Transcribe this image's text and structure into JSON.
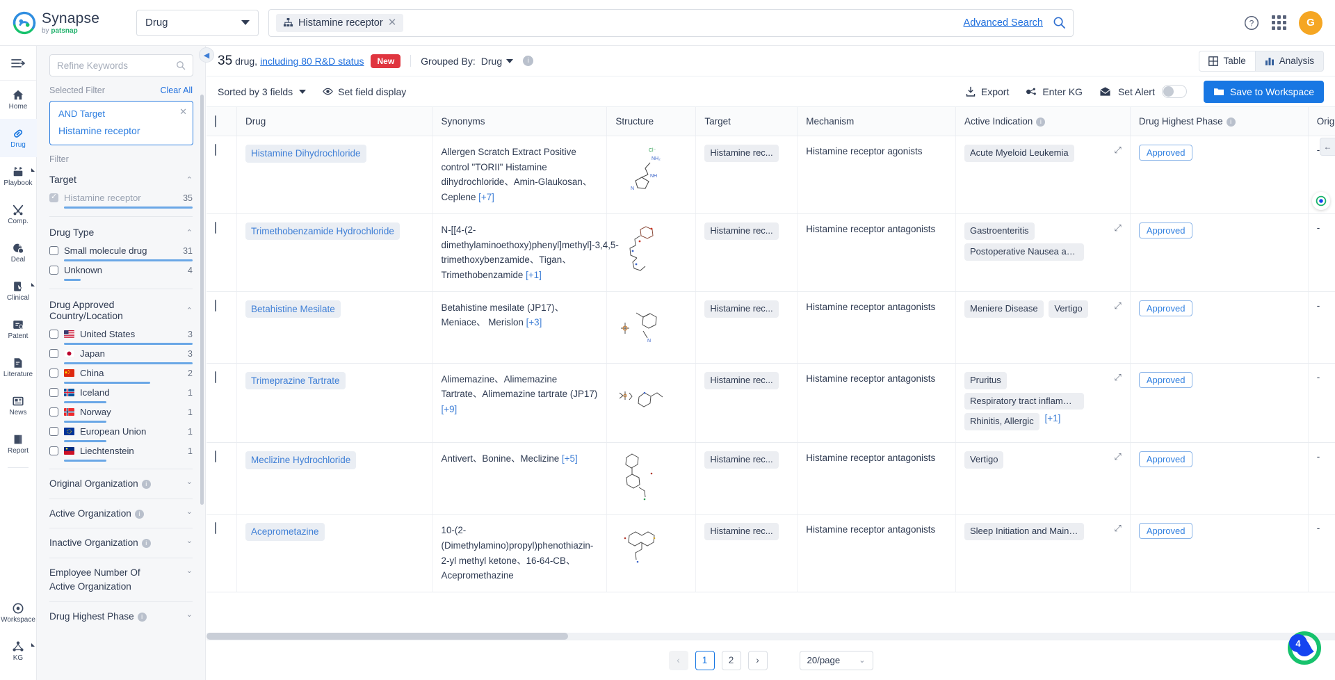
{
  "brand": {
    "name": "Synapse",
    "by": "by",
    "company": "patsnap"
  },
  "topbar": {
    "entity_select": "Drug",
    "query_chip": "Histamine receptor",
    "query_chip_icon": "target-hierarchy-icon",
    "advanced_search": "Advanced Search",
    "search_icon": "search-icon",
    "help_icon": "help-circle-icon",
    "apps_icon": "apps-grid-icon",
    "avatar_initial": "G",
    "avatar_color": "#f5a623"
  },
  "rail": {
    "toggle": "collapse-rail",
    "items": [
      {
        "label": "Home",
        "icon": "home-icon",
        "active": false,
        "sub": false
      },
      {
        "label": "Drug",
        "icon": "capsule-icon",
        "active": true,
        "sub": false
      },
      {
        "label": "Playbook",
        "icon": "playbook-icon",
        "active": false,
        "sub": true
      },
      {
        "label": "Comp.",
        "icon": "competition-icon",
        "active": false,
        "sub": false
      },
      {
        "label": "Deal",
        "icon": "deal-icon",
        "active": false,
        "sub": false
      },
      {
        "label": "Clinical",
        "icon": "clinical-icon",
        "active": false,
        "sub": true
      },
      {
        "label": "Patent",
        "icon": "patent-icon",
        "active": false,
        "sub": false
      },
      {
        "label": "Literature",
        "icon": "literature-icon",
        "active": false,
        "sub": false
      },
      {
        "label": "News",
        "icon": "news-icon",
        "active": false,
        "sub": false
      },
      {
        "label": "Report",
        "icon": "report-icon",
        "active": false,
        "sub": false
      }
    ],
    "bottom_items": [
      {
        "label": "Workspace",
        "icon": "workspace-icon"
      },
      {
        "label": "KG",
        "icon": "knowledge-graph-icon",
        "sub": true
      }
    ]
  },
  "sidebar": {
    "refine_placeholder": "Refine Keywords",
    "selected_filter_label": "Selected Filter",
    "clear_all": "Clear All",
    "selected": {
      "operator": "AND Target",
      "value": "Histamine receptor"
    },
    "filter_label": "Filter",
    "groups": [
      {
        "title": "Target",
        "expanded": true,
        "items": [
          {
            "label": "Histamine receptor",
            "count": "35",
            "checked": true,
            "bar": 100,
            "flag": null
          }
        ]
      },
      {
        "title": "Drug Type",
        "expanded": true,
        "items": [
          {
            "label": "Small molecule drug",
            "count": "31",
            "checked": false,
            "bar": 100,
            "flag": null
          },
          {
            "label": "Unknown",
            "count": "4",
            "checked": false,
            "bar": 13,
            "flag": null
          }
        ]
      },
      {
        "title": "Drug Approved Country/Location",
        "expanded": true,
        "items": [
          {
            "label": "United States",
            "count": "3",
            "checked": false,
            "bar": 100,
            "flag": "us"
          },
          {
            "label": "Japan",
            "count": "3",
            "checked": false,
            "bar": 100,
            "flag": "jp"
          },
          {
            "label": "China",
            "count": "2",
            "checked": false,
            "bar": 67,
            "flag": "cn"
          },
          {
            "label": "Iceland",
            "count": "1",
            "checked": false,
            "bar": 33,
            "flag": "is"
          },
          {
            "label": "Norway",
            "count": "1",
            "checked": false,
            "bar": 33,
            "flag": "no"
          },
          {
            "label": "European Union",
            "count": "1",
            "checked": false,
            "bar": 33,
            "flag": "eu"
          },
          {
            "label": "Liechtenstein",
            "count": "1",
            "checked": false,
            "bar": 33,
            "flag": "li"
          }
        ]
      }
    ],
    "collapsed_groups": [
      {
        "title": "Original Organization",
        "info": true
      },
      {
        "title": "Active Organization",
        "info": true
      },
      {
        "title": "Inactive Organization",
        "info": true
      },
      {
        "title": "Employee Number Of Active Organization",
        "info": false
      },
      {
        "title": "Drug Highest Phase",
        "info": true
      }
    ]
  },
  "results_header": {
    "count": "35",
    "unit": "drug,",
    "rd_status_link": "including 80 R&D status",
    "new_badge": "New",
    "grouped_by_label": "Grouped By:",
    "grouped_by_value": "Drug",
    "info_icon": "info-icon",
    "view_table": "Table",
    "view_analysis": "Analysis"
  },
  "toolbar": {
    "sorted_by": "Sorted by 3 fields",
    "set_field_display": "Set field display",
    "export": "Export",
    "enter_kg": "Enter KG",
    "set_alert": "Set Alert",
    "alert_enabled": false,
    "save_to_workspace": "Save to Workspace"
  },
  "table": {
    "columns": [
      {
        "key": "check",
        "label": ""
      },
      {
        "key": "drug",
        "label": "Drug",
        "info": false
      },
      {
        "key": "synonyms",
        "label": "Synonyms",
        "info": false
      },
      {
        "key": "structure",
        "label": "Structure",
        "info": false
      },
      {
        "key": "target",
        "label": "Target",
        "info": false
      },
      {
        "key": "mechanism",
        "label": "Mechanism",
        "info": false
      },
      {
        "key": "indication",
        "label": "Active Indication",
        "info": true
      },
      {
        "key": "phase",
        "label": "Drug Highest Phase",
        "info": true
      },
      {
        "key": "origin",
        "label": "Origi",
        "info": false
      }
    ],
    "rows": [
      {
        "drug": "Histamine Dihydrochloride",
        "synonyms": "Allergen Scratch Extract Positive control \"TORII\" Histamine dihydrochloride、Amin-Glaukosan、 Ceplene",
        "synonyms_more": "[+7]",
        "target": "Histamine rec...",
        "mechanism": "Histamine receptor agonists",
        "indications": [
          "Acute Myeloid Leukemia"
        ],
        "indications_more": "",
        "phase": "Approved",
        "origin": "-"
      },
      {
        "drug": "Trimethobenzamide Hydrochloride",
        "synonyms": "N-[[4-(2-dimethylaminoethoxy)phenyl]methyl]-3,4,5-trimethoxybenzamide、Tigan、 Trimethobenzamide",
        "synonyms_more": "[+1]",
        "target": "Histamine rec...",
        "mechanism": "Histamine receptor antagonists",
        "indications": [
          "Gastroenteritis",
          "Postoperative Nausea and ..."
        ],
        "indications_more": "",
        "phase": "Approved",
        "origin": "-"
      },
      {
        "drug": "Betahistine Mesilate",
        "synonyms": "Betahistine mesilate (JP17)、Meniace、 Merislon",
        "synonyms_more": "[+3]",
        "target": "Histamine rec...",
        "mechanism": "Histamine receptor antagonists",
        "indications": [
          "Meniere Disease",
          "Vertigo"
        ],
        "indications_more": "",
        "phase": "Approved",
        "origin": "-"
      },
      {
        "drug": "Trimeprazine Tartrate",
        "synonyms": "Alimemazine、Alimemazine Tartrate、Alimemazine tartrate (JP17)",
        "synonyms_more": "[+9]",
        "target": "Histamine rec...",
        "mechanism": "Histamine receptor antagonists",
        "indications": [
          "Pruritus",
          "Respiratory tract inflammat...",
          "Rhinitis, Allergic"
        ],
        "indications_more": "[+1]",
        "phase": "Approved",
        "origin": "-"
      },
      {
        "drug": "Meclizine Hydrochloride",
        "synonyms": "Antivert、Bonine、Meclizine",
        "synonyms_more": "[+5]",
        "target": "Histamine rec...",
        "mechanism": "Histamine receptor antagonists",
        "indications": [
          "Vertigo"
        ],
        "indications_more": "",
        "phase": "Approved",
        "origin": "-"
      },
      {
        "drug": "Aceprometazine",
        "synonyms": "10-(2-(Dimethylamino)propyl)phenothiazin-2-yl methyl ketone、16-64-CB、Acepromethazine",
        "synonyms_more": "",
        "target": "Histamine rec...",
        "mechanism": "Histamine receptor antagonists",
        "indications": [
          "Sleep Initiation and Mainte..."
        ],
        "indications_more": "",
        "phase": "Approved",
        "origin": "-"
      }
    ]
  },
  "pagination": {
    "prev": "‹",
    "pages": [
      "1",
      "2"
    ],
    "current": "1",
    "next": "›",
    "page_size": "20/page"
  },
  "chat_fab": {
    "badge": "4",
    "icon": "assistant-icon"
  },
  "colors": {
    "accent": "#1877e3",
    "link": "#1f6fdd",
    "badge_new": "#e0353f",
    "bar": "#6aa7e6",
    "fab_green": "#17c26d",
    "fab_blue": "#1544f0"
  }
}
